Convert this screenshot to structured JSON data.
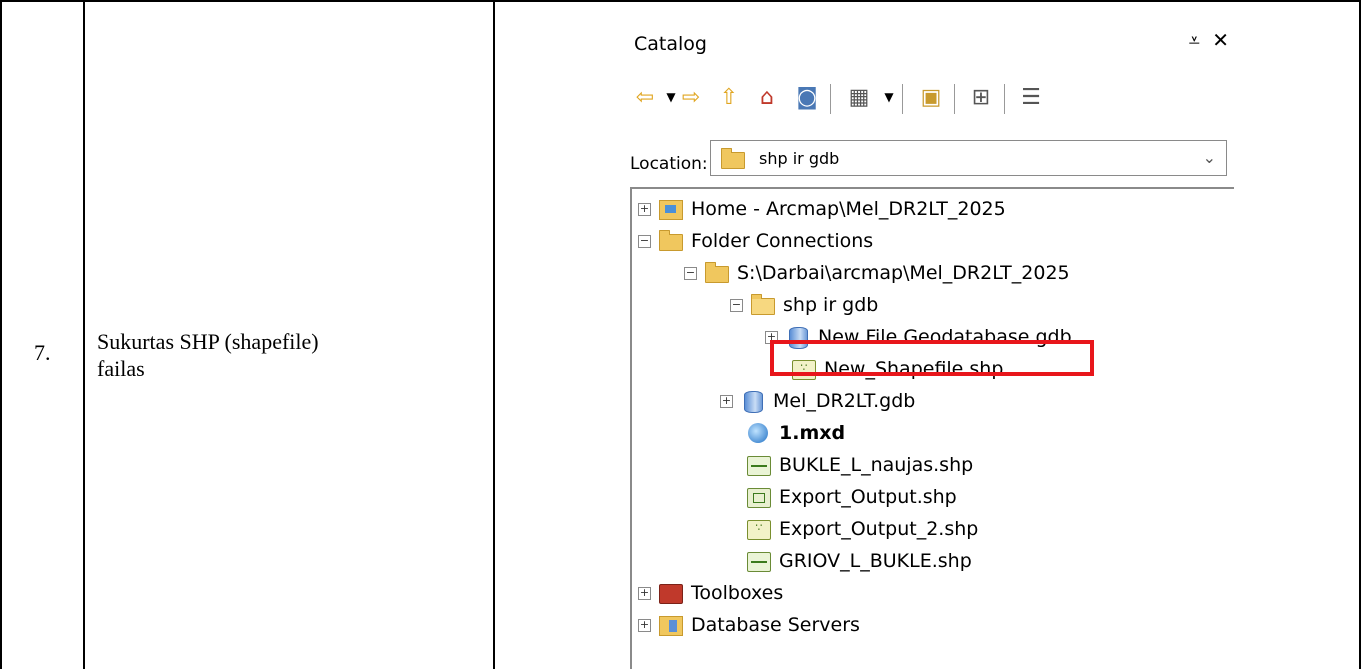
{
  "row": {
    "number": "7.",
    "description_line1": "Sukurtas SHP (shapefile)",
    "description_line2": "failas"
  },
  "catalog": {
    "title": "Catalog",
    "pin_icon": "pin-icon",
    "close_icon": "close-icon",
    "pin_glyph": "⩡",
    "close_glyph": "✕",
    "toolbar_icons": [
      "back-icon",
      "back-dropdown-icon",
      "forward-icon",
      "up-one-level-icon",
      "home-icon",
      "default-gdb-icon",
      "view-options-icon",
      "view-dropdown-icon",
      "connect-folder-icon",
      "toggle-contents-icon",
      "options-icon"
    ],
    "location_label": "Location:",
    "location_value": "shp ir gdb",
    "tree": [
      {
        "label": "Home - Arcmap\\Mel_DR2LT_2025",
        "icon": "home-folder-icon",
        "expander": "+"
      },
      {
        "label": "Folder Connections",
        "icon": "folder-icon",
        "expander": "−"
      },
      {
        "label": "S:\\Darbai\\arcmap\\Mel_DR2LT_2025",
        "icon": "folder-icon",
        "expander": "−"
      },
      {
        "label": "shp ir gdb",
        "icon": "open-folder-icon",
        "expander": "−"
      },
      {
        "label": "New File Geodatabase.gdb",
        "icon": "geodatabase-icon",
        "expander": "+"
      },
      {
        "label": "New_Shapefile.shp",
        "icon": "point-shapefile-icon",
        "expander": ""
      },
      {
        "label": "Mel_DR2LT.gdb",
        "icon": "geodatabase-icon",
        "expander": "+"
      },
      {
        "label": "1.mxd",
        "icon": "map-document-icon",
        "expander": ""
      },
      {
        "label": "BUKLE_L_naujas.shp",
        "icon": "line-shapefile-icon",
        "expander": ""
      },
      {
        "label": "Export_Output.shp",
        "icon": "polygon-shapefile-icon",
        "expander": ""
      },
      {
        "label": "Export_Output_2.shp",
        "icon": "point-shapefile-icon",
        "expander": ""
      },
      {
        "label": "GRIOV_L_BUKLE.shp",
        "icon": "line-shapefile-icon",
        "expander": ""
      },
      {
        "label": "Toolboxes",
        "icon": "toolbox-icon",
        "expander": "+"
      },
      {
        "label": "Database Servers",
        "icon": "database-server-icon",
        "expander": "+"
      }
    ],
    "highlight_color": "#e8161b"
  }
}
